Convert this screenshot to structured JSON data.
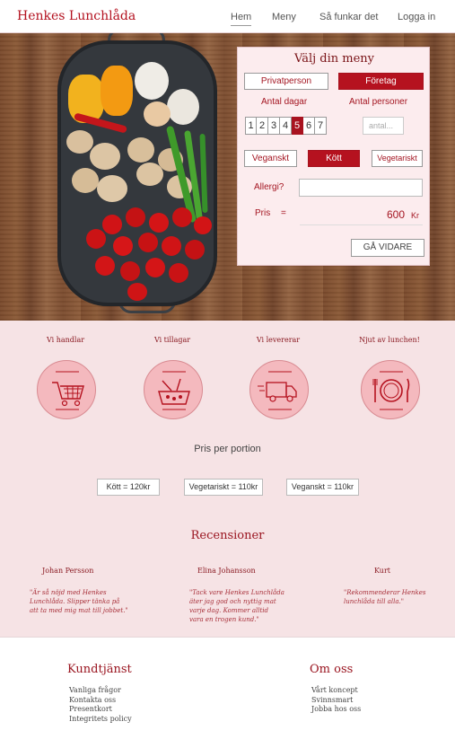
{
  "header": {
    "logo": "Henkes Lunchlåda",
    "nav": [
      {
        "label": "Hem"
      },
      {
        "label": "Meny"
      },
      {
        "label": "Så funkar det"
      },
      {
        "label": "Logga in"
      }
    ]
  },
  "menu_panel": {
    "title": "Välj din meny",
    "customer_types": [
      "Privatperson",
      "Företag"
    ],
    "selected_customer_type": "Företag",
    "days_label": "Antal dagar",
    "persons_label": "Antal personer",
    "days": [
      "1",
      "2",
      "3",
      "4",
      "5",
      "6",
      "7"
    ],
    "selected_day": "5",
    "persons_placeholder": "antal...",
    "diets": [
      "Veganskt",
      "Kött",
      "Vegetariskt"
    ],
    "selected_diet": "Kött",
    "allergy_label": "Allergi?",
    "price_label": "Pris",
    "price_equals": "=",
    "price_value": "600",
    "price_unit": "Kr",
    "continue_label": "GÅ VIDARE"
  },
  "steps": [
    {
      "label": "Vi handlar",
      "icon": "shopping-cart-icon"
    },
    {
      "label": "Vi tillagar",
      "icon": "cooking-pot-icon"
    },
    {
      "label": "Vi levererar",
      "icon": "delivery-truck-icon"
    },
    {
      "label": "Njut av lunchen!",
      "icon": "plate-cutlery-icon"
    }
  ],
  "pricing": {
    "title": "Pris per portion",
    "items": [
      "Kött = 120kr",
      "Vegetariskt = 110kr",
      "Veganskt = 110kr"
    ]
  },
  "reviews": {
    "title": "Recensioner",
    "items": [
      {
        "name": "Johan Persson",
        "text_lines": [
          "\"Är så nöjd med Henkes",
          "Lunchlåda. Slipper tänka på",
          "att ta med mig mat till jobbet.\""
        ]
      },
      {
        "name": "Elina Johansson",
        "text_lines": [
          "\"Tack vare Henkes Lunchlåda",
          "äter jag god och nyttig mat",
          "varje dag. Kommer alltid",
          "vara en trogen kund.\""
        ]
      },
      {
        "name": "Kurt",
        "text_lines": [
          "\"Rekommenderar Henkes",
          "lunchlåda till alla.\""
        ]
      }
    ]
  },
  "footer": {
    "support": {
      "title": "Kundtjänst",
      "links": [
        "Vanliga frågor",
        "Kontakta oss",
        "Presentkort",
        "Integritets policy"
      ]
    },
    "about": {
      "title": "Om oss",
      "links": [
        "Vårt koncept",
        "Svinnsmart",
        "Jobba hos oss"
      ]
    }
  },
  "colors": {
    "brand_red": "#b5121f",
    "pink_bg": "#f6e3e5",
    "panel_bg": "#fcecee"
  }
}
